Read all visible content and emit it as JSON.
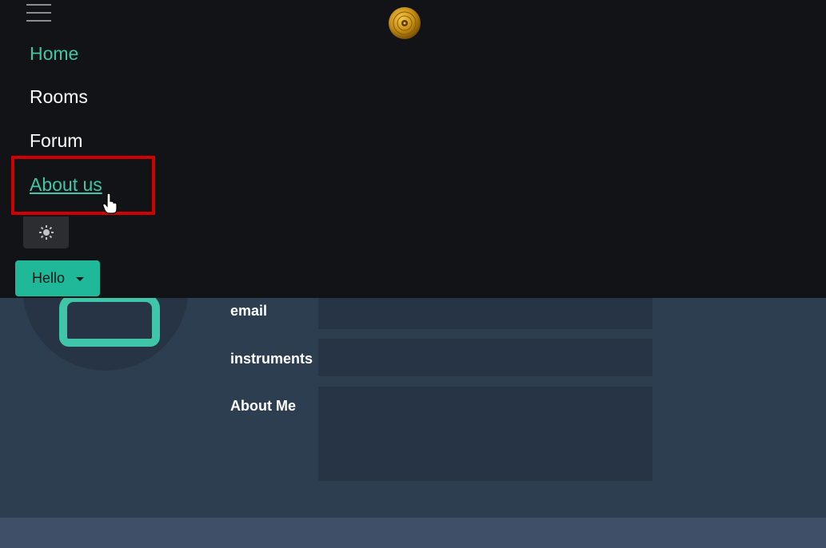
{
  "nav": {
    "links": [
      {
        "label": "Home"
      },
      {
        "label": "Rooms"
      },
      {
        "label": "Forum"
      },
      {
        "label": "About us"
      }
    ],
    "theme_toggle_icon": "sun-icon",
    "user_menu_label": "Hello",
    "logo_icon": "vinyl-record-icon",
    "menu_icon": "hamburger-icon"
  },
  "profile": {
    "fields": [
      {
        "label": "email",
        "value": ""
      },
      {
        "label": "instruments",
        "value": ""
      },
      {
        "label": "About Me",
        "value": ""
      }
    ]
  },
  "colors": {
    "accent": "#1fb999",
    "nav_bg": "#121316",
    "page_bg": "#2e3e51",
    "highlight": "#d00000"
  }
}
